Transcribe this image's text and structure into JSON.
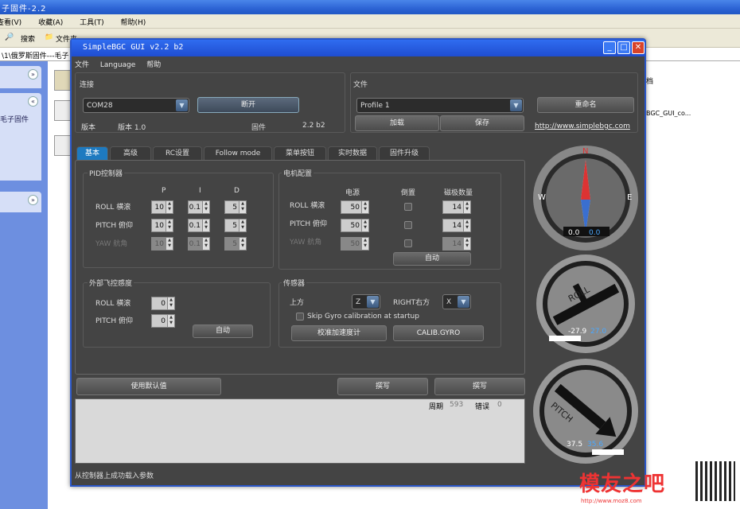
{
  "bg": {
    "title": "子固件-2.2",
    "menu": [
      "查看(V)",
      "收藏(A)",
      "工具(T)",
      "帮助(H)"
    ],
    "toolbar": [
      "搜索",
      "文件夹"
    ],
    "address": "\\1\\俄罗斯固件---毛子",
    "side_text": "毛子固件",
    "ext1": "档",
    "ext2": "BGC_GUI_co..."
  },
  "app": {
    "title": "SimpleBGC GUI v2.2 b2",
    "menu": [
      "文件",
      "Language",
      "帮助"
    ],
    "connection": {
      "title": "连接",
      "port": "COM28",
      "disconnect": "断开",
      "version_label": "版本",
      "version_value": "版本 1.0",
      "firmware_label": "固件",
      "firmware_value": "2.2 b2"
    },
    "file": {
      "title": "文件",
      "profile": "Profile 1",
      "rename": "重命名",
      "load": "加载",
      "save": "保存",
      "link": "http://www.simplebgc.com"
    },
    "tabs": [
      "基本",
      "高级",
      "RC设置",
      "Follow mode",
      "菜单按钮",
      "实时数据",
      "固件升级"
    ],
    "pid": {
      "title": "PID控制器",
      "cols": [
        "P",
        "I",
        "D"
      ],
      "rows": [
        {
          "label": "ROLL 横滚",
          "p": "10",
          "i": "0.1",
          "d": "5",
          "enabled": true
        },
        {
          "label": "PITCH 俯仰",
          "p": "10",
          "i": "0.1",
          "d": "5",
          "enabled": true
        },
        {
          "label": "YAW 航角",
          "p": "10",
          "i": "0.1",
          "d": "5",
          "enabled": false
        }
      ]
    },
    "motor": {
      "title": "电机配置",
      "cols": [
        "电源",
        "倒置",
        "磁极数量"
      ],
      "rows": [
        {
          "label": "ROLL 横滚",
          "power": "50",
          "poles": "14",
          "enabled": true
        },
        {
          "label": "PITCH 俯仰",
          "power": "50",
          "poles": "14",
          "enabled": true
        },
        {
          "label": "YAW 航角",
          "power": "50",
          "poles": "14",
          "enabled": false
        }
      ],
      "auto": "自动"
    },
    "external": {
      "title": "外部飞控感度",
      "rows": [
        {
          "label": "ROLL 横滚",
          "value": "0"
        },
        {
          "label": "PITCH 俯仰",
          "value": "0"
        }
      ],
      "auto": "自动"
    },
    "sensor": {
      "title": "传感器",
      "top_label": "上方",
      "top_value": "Z",
      "right_label": "RIGHT右方",
      "right_value": "X",
      "skip_gyro": "Skip Gyro calibration at startup",
      "calib_acc": "校准加速度计",
      "calib_gyro": "CALIB.GYRO"
    },
    "use_defaults": "使用默认值",
    "write1": "撰写",
    "write2": "撰写",
    "log": {
      "period_label": "周期",
      "period_value": "593",
      "error_label": "错误",
      "error_value": "0"
    },
    "status": "从控制器上成功载入参数",
    "gauges": {
      "yaw": {
        "left": "0.0",
        "right": "0.0",
        "n": "N",
        "e": "E",
        "w": "W"
      },
      "roll": {
        "label": "ROLL",
        "left": "-27.9",
        "right": "27.0"
      },
      "pitch": {
        "label": "PITCH",
        "left": "37.5",
        "right": "35.6"
      }
    }
  },
  "watermark": {
    "text": "模友之吧",
    "url": "http://www.moz8.com"
  }
}
